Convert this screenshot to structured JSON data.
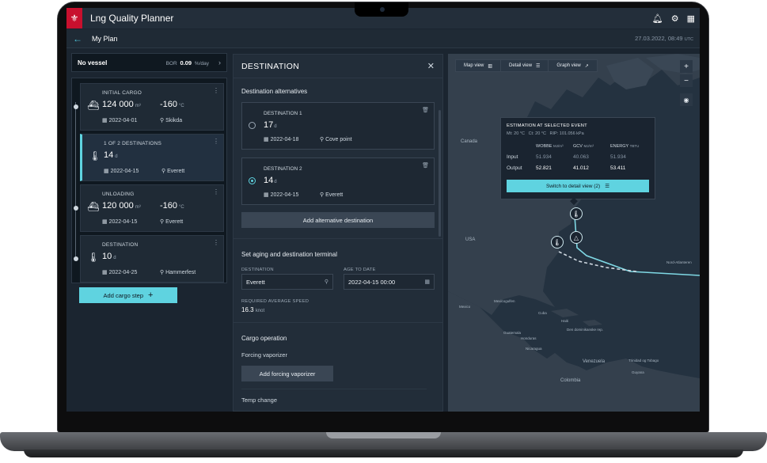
{
  "app": {
    "title": "Lng Quality Planner",
    "page_title": "My Plan",
    "datetime": "27.03.2022, 08:49",
    "timezone": "UTC",
    "accent_color": "#5fd3e0",
    "brand_color": "#c8102e"
  },
  "vessel": {
    "name": "No vessel",
    "bor_label": "BOR",
    "bor_value": "0.09",
    "bor_unit": "%/day"
  },
  "steps": [
    {
      "label": "INITIAL CARGO",
      "icon": "ship-icon",
      "value": "124 000",
      "value_unit": "m³",
      "value2": "-160",
      "value2_unit": "°C",
      "date": "2022-04-01",
      "place": "Skikda"
    },
    {
      "label": "1 OF 2 DESTINATIONS",
      "icon": "thermometer-icon",
      "value": "14",
      "value_unit": "d",
      "date": "2022-04-15",
      "place": "Everett"
    },
    {
      "label": "UNLOADING",
      "icon": "ship-unload-icon",
      "value": "120 000",
      "value_unit": "m³",
      "value2": "-160",
      "value2_unit": "°C",
      "date": "2022-04-15",
      "place": "Everett"
    },
    {
      "label": "DESTINATION",
      "icon": "thermometer-icon",
      "value": "10",
      "value_unit": "d",
      "date": "2022-04-25",
      "place": "Hammerfest"
    }
  ],
  "add_cargo_step": "Add cargo step",
  "destination_panel": {
    "title": "DESTINATION",
    "alternatives_title": "Destination alternatives",
    "alternatives": [
      {
        "label": "DESTINATION 1",
        "days": "17",
        "days_unit": "d",
        "date": "2022-04-18",
        "place": "Cove point",
        "selected": false
      },
      {
        "label": "DESTINATION 2",
        "days": "14",
        "days_unit": "d",
        "date": "2022-04-15",
        "place": "Everett",
        "selected": true
      }
    ],
    "add_alternative": "Add alternative destination",
    "aging_title": "Set aging and destination terminal",
    "destination_label": "DESTINATION",
    "destination_value": "Everett",
    "age_label": "AGE TO DATE",
    "age_value": "2022-04-15 00:00",
    "speed_label": "REQUIRED AVERAGE SPEED",
    "speed_value": "16.3",
    "speed_unit": "knot",
    "cargo_op_title": "Cargo operation",
    "forcing_label": "Forcing vaporizer",
    "forcing_button": "Add forcing vaporizer",
    "temp_change": "Temp change"
  },
  "map": {
    "tabs": [
      "Map view",
      "Detail view",
      "Graph view"
    ],
    "labels": {
      "canada": "Canada",
      "usa": "USA",
      "mexico": "Mexico",
      "venezuela": "Venezuela",
      "colombia": "Colombia",
      "nord_atlanteren": "Nord-Atlanteren",
      "mexicogulfen": "Mexicogulfen",
      "cuba": "Cuba",
      "haiti": "Haiti",
      "dr": "Den dominikanske rep.",
      "guatemala": "Guatemala",
      "nicaragua": "Nicaragua",
      "honduras": "Honduras",
      "trinidad": "Trinidad og Tobago",
      "guyana": "Guyana"
    },
    "estimation": {
      "title": "ESTIMATION AT SELECTED EVENT",
      "mt": "Mt: 20 °C",
      "ct": "Ct: 20 °C",
      "rip": "RIP: 101.056 kPa",
      "columns": [
        {
          "name": "WOBBE",
          "unit": "MJ/m³"
        },
        {
          "name": "GCV",
          "unit": "MJ/m³"
        },
        {
          "name": "ENERGY",
          "unit": "TBTU"
        }
      ],
      "input_label": "Input",
      "output_label": "Output",
      "input": [
        "51.934",
        "40.063",
        "51.934"
      ],
      "output": [
        "52.821",
        "41.012",
        "53.411"
      ],
      "button": "Switch to detail view (2)"
    }
  }
}
